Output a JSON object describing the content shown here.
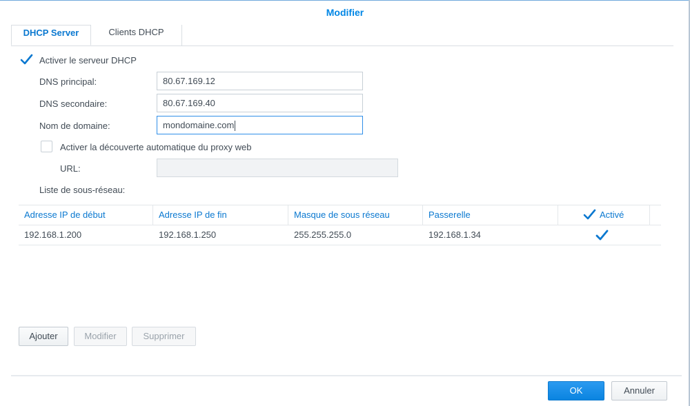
{
  "dialog": {
    "title": "Modifier"
  },
  "tabs": [
    {
      "label": "DHCP Server",
      "active": true
    },
    {
      "label": "Clients DHCP",
      "active": false
    }
  ],
  "form": {
    "enable_dhcp": {
      "label": "Activer le serveur DHCP",
      "checked": true
    },
    "dns_primary": {
      "label": "DNS principal:",
      "value": "80.67.169.12"
    },
    "dns_secondary": {
      "label": "DNS secondaire:",
      "value": "80.67.169.40"
    },
    "domain_name": {
      "label": "Nom de domaine:",
      "value": "mondomaine.com"
    },
    "proxy_autodiscovery": {
      "label": "Activer la découverte automatique du proxy web",
      "checked": false
    },
    "url": {
      "label": "URL:",
      "value": ""
    },
    "subnet_list_label": "Liste de sous-réseau:"
  },
  "subnet_table": {
    "columns": [
      "Adresse IP de début",
      "Adresse IP de fin",
      "Masque de sous réseau",
      "Passerelle",
      "Activé"
    ],
    "rows": [
      {
        "start": "192.168.1.200",
        "end": "192.168.1.250",
        "mask": "255.255.255.0",
        "gateway": "192.168.1.34",
        "enabled": true
      }
    ]
  },
  "table_buttons": {
    "add": "Ajouter",
    "edit": "Modifier",
    "delete": "Supprimer"
  },
  "footer": {
    "ok": "OK",
    "cancel": "Annuler"
  },
  "colors": {
    "accent": "#0086e5",
    "check": "#0a78d0"
  }
}
